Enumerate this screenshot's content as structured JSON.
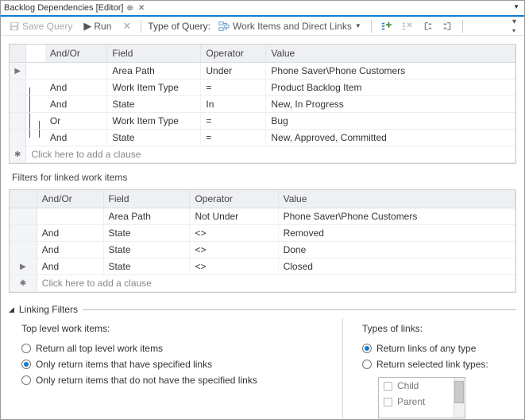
{
  "tab": {
    "title": "Backlog Dependencies [Editor]"
  },
  "toolbar": {
    "save_label": "Save Query",
    "run_label": "Run",
    "type_label": "Type of Query:",
    "query_type": "Work Items and Direct Links"
  },
  "columns": {
    "andor": "And/Or",
    "field": "Field",
    "operator": "Operator",
    "value": "Value"
  },
  "top_clauses": [
    {
      "andor": "",
      "field": "Area Path",
      "operator": "Under",
      "value": "Phone Saver\\Phone Customers",
      "gutter": "▶"
    },
    {
      "andor": "And",
      "field": "Work Item Type",
      "operator": "=",
      "value": "Product Backlog Item"
    },
    {
      "andor": "And",
      "field": "State",
      "operator": "In",
      "value": "New, In Progress"
    },
    {
      "andor": "Or",
      "field": "Work Item Type",
      "operator": "=",
      "value": "Bug"
    },
    {
      "andor": "And",
      "field": "State",
      "operator": "=",
      "value": "New, Approved, Committed"
    }
  ],
  "add_clause": "Click here to add a clause",
  "linked_section_title": "Filters for linked work items",
  "linked_clauses": [
    {
      "andor": "",
      "field": "Area Path",
      "operator": "Not Under",
      "value": "Phone Saver\\Phone Customers"
    },
    {
      "andor": "And",
      "field": "State",
      "operator": "<>",
      "value": "Removed"
    },
    {
      "andor": "And",
      "field": "State",
      "operator": "<>",
      "value": "Done"
    },
    {
      "andor": "And",
      "field": "State",
      "operator": "<>",
      "value": "Closed",
      "gutter": "▶"
    }
  ],
  "linking": {
    "title": "Linking Filters",
    "left_title": "Top level work items:",
    "right_title": "Types of links:",
    "left_options": [
      {
        "label": "Return all top level work items",
        "checked": false
      },
      {
        "label": "Only return items that have specified links",
        "checked": true
      },
      {
        "label": "Only return items that do not have the specified links",
        "checked": false
      }
    ],
    "right_options": [
      {
        "label": "Return links of any type",
        "checked": true
      },
      {
        "label": "Return selected link types:",
        "checked": false
      }
    ],
    "link_types": [
      {
        "label": "Child",
        "checked": false
      },
      {
        "label": "Parent",
        "checked": false
      }
    ]
  }
}
